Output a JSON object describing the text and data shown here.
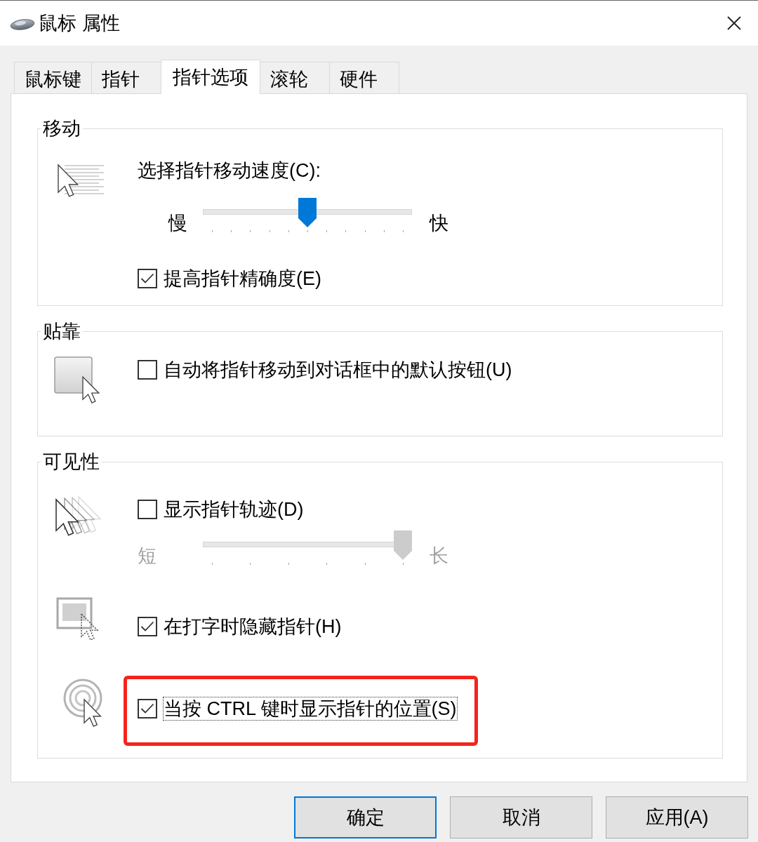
{
  "window": {
    "title": "鼠标 属性"
  },
  "tabs": [
    {
      "label": "鼠标键",
      "selected": false
    },
    {
      "label": "指针",
      "selected": false
    },
    {
      "label": "指针选项",
      "selected": true
    },
    {
      "label": "滚轮",
      "selected": false
    },
    {
      "label": "硬件",
      "selected": false
    }
  ],
  "groups": [
    {
      "title": "移动",
      "sections": [
        {
          "items": [
            {
              "kind": "slider",
              "label": "选择指针移动速度(C):",
              "min_label": "慢",
              "max_label": "快",
              "level": 0.5,
              "disabled": false
            },
            {
              "kind": "checkbox",
              "label": "提高指针精确度(E)",
              "checked": true,
              "focused": false,
              "highlighted": false
            }
          ]
        }
      ]
    },
    {
      "title": "贴靠",
      "sections": [
        {
          "items": [
            {
              "kind": "checkbox",
              "label": "自动将指针移动到对话框中的默认按钮(U)",
              "checked": false,
              "focused": false,
              "highlighted": false
            }
          ]
        }
      ]
    },
    {
      "title": "可见性",
      "sections": [
        {
          "items": [
            {
              "kind": "checkbox",
              "label": "显示指针轨迹(D)",
              "checked": false,
              "focused": false,
              "highlighted": false
            },
            {
              "kind": "slider",
              "min_label": "短",
              "max_label": "长",
              "level": 1,
              "disabled": true
            }
          ]
        },
        {
          "items": [
            {
              "kind": "checkbox",
              "label": "在打字时隐藏指针(H)",
              "checked": true,
              "focused": false,
              "highlighted": false
            }
          ]
        },
        {
          "items": [
            {
              "kind": "checkbox",
              "label": "当按 CTRL 键时显示指针的位置(S)",
              "checked": true,
              "focused": true,
              "highlighted": true
            }
          ]
        }
      ]
    }
  ],
  "buttons": [
    {
      "label": "确定",
      "default": true
    },
    {
      "label": "取消",
      "default": false
    },
    {
      "label": "应用(A)",
      "default": false
    }
  ]
}
